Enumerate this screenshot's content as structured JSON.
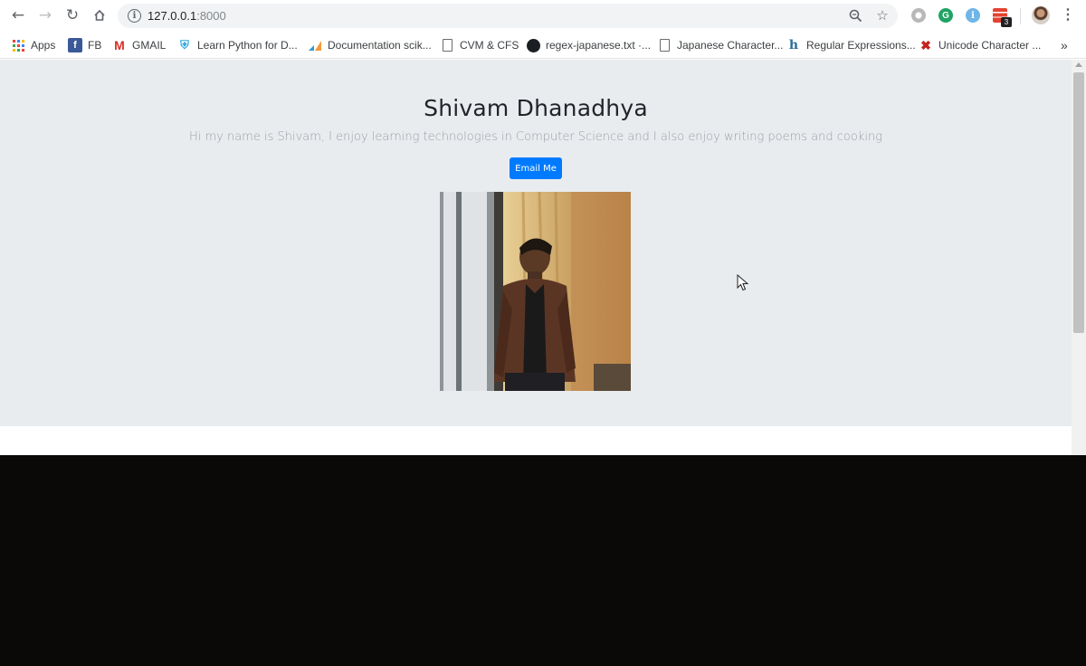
{
  "browser": {
    "url_host": "127.0.0.1",
    "url_port": ":8000",
    "extension_badge": "3"
  },
  "bookmarks": [
    {
      "label": "Apps",
      "icon": "apps-grid-icon"
    },
    {
      "label": "FB",
      "icon": "facebook-icon"
    },
    {
      "label": "GMAIL",
      "icon": "gmail-icon"
    },
    {
      "label": "Learn Python for D...",
      "icon": "shield-icon"
    },
    {
      "label": "Documentation scik...",
      "icon": "scikit-learn-icon"
    },
    {
      "label": "CVM & CFS",
      "icon": "document-icon"
    },
    {
      "label": "regex-japanese.txt ·...",
      "icon": "github-icon"
    },
    {
      "label": "Japanese Character...",
      "icon": "document-icon"
    },
    {
      "label": "Regular Expressions...",
      "icon": "hm-icon"
    },
    {
      "label": "Unicode Character ...",
      "icon": "unicode-icon"
    }
  ],
  "page": {
    "heading": "Shivam Dhanadhya",
    "lead": "Hi my name is Shivam, I enjoy learning technologies in Computer Science and I also enjoy writing poems and cooking",
    "email_button": "Email Me"
  },
  "colors": {
    "jumbotron_bg": "#e9ecef",
    "button_primary": "#007bff"
  }
}
